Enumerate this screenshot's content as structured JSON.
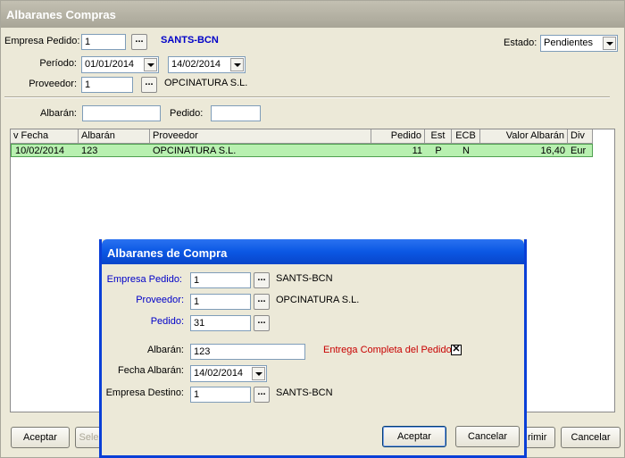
{
  "window": {
    "title": "Albaranes Compras"
  },
  "filters": {
    "empresa_label": "Empresa Pedido:",
    "empresa_value": "1",
    "empresa_name": "SANTS-BCN",
    "periodo_label": "Período:",
    "periodo_from": "01/01/2014",
    "periodo_to": "14/02/2014",
    "proveedor_label": "Proveedor:",
    "proveedor_value": "1",
    "proveedor_name": "OPCINATURA S.L.",
    "estado_label": "Estado:",
    "estado_value": "Pendientes",
    "albaran_label": "Albarán:",
    "albaran_value": "",
    "pedido_label": "Pedido:",
    "pedido_value": "",
    "dots": "..."
  },
  "grid": {
    "columns": [
      "v Fecha",
      "Albarán",
      "Proveedor",
      "Pedido",
      "Est",
      "ECB",
      "Valor Albarán",
      "Div"
    ],
    "rows": [
      [
        "10/02/2014",
        "123",
        "OPCINATURA S.L.",
        "11",
        "P",
        "N",
        "16,40",
        "Eur"
      ]
    ],
    "selected_row_color": "#b8f0b0"
  },
  "bottom_buttons": {
    "aceptar": "Aceptar",
    "seleccionar_partial": "Sele",
    "imprimir_partial": "rimir",
    "cancelar": "Cancelar"
  },
  "dialog": {
    "title": "Albaranes de Compra",
    "empresa_label": "Empresa Pedido:",
    "empresa_value": "1",
    "empresa_name": "SANTS-BCN",
    "proveedor_label": "Proveedor:",
    "proveedor_value": "1",
    "proveedor_name": "OPCINATURA S.L.",
    "pedido_label": "Pedido:",
    "pedido_value": "31",
    "albaran_label": "Albarán:",
    "albaran_value": "123",
    "entrega_label": "Entrega Completa del Pedido",
    "entrega_checked": true,
    "fecha_label": "Fecha Albarán:",
    "fecha_value": "14/02/2014",
    "destino_label": "Empresa Destino:",
    "destino_value": "1",
    "destino_name": "SANTS-BCN",
    "aceptar": "Aceptar",
    "cancelar": "Cancelar",
    "title_color": "#0b57e4"
  }
}
